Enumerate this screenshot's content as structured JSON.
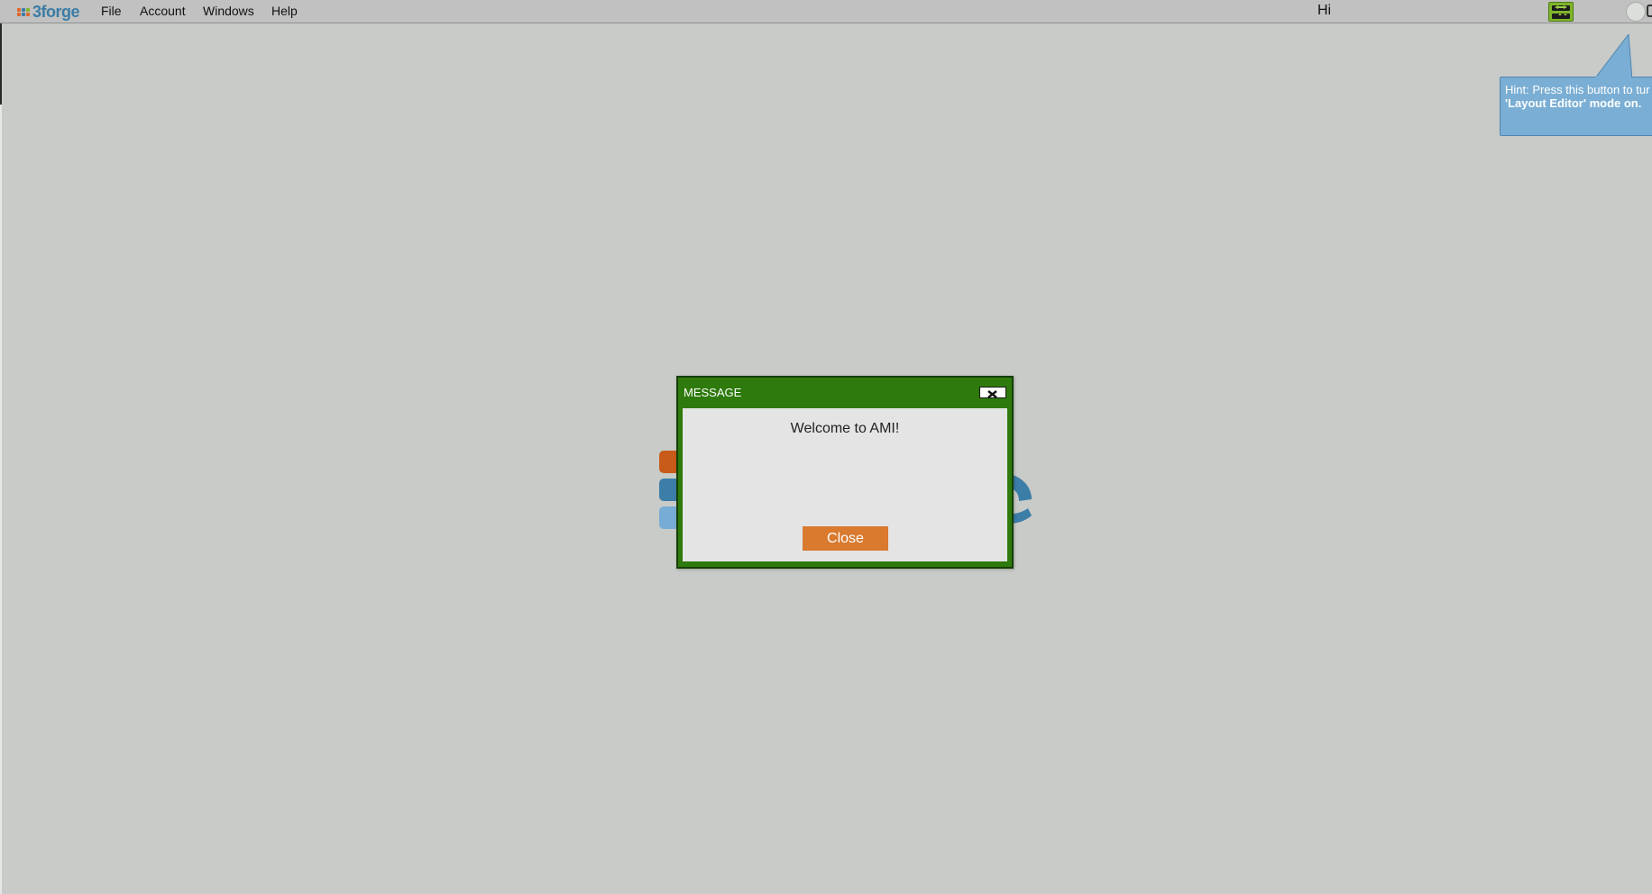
{
  "app": {
    "logo_text": "3forge",
    "logo_dot_colors": [
      "#e0662a",
      "#3b7ca6",
      "#7fb52a",
      "#e0662a",
      "#3b7ca6",
      "#e0662a"
    ]
  },
  "menu": {
    "items": [
      {
        "label": "File"
      },
      {
        "label": "Account"
      },
      {
        "label": "Windows"
      },
      {
        "label": "Help"
      }
    ]
  },
  "header": {
    "greeting": "Hi",
    "layout_editor_icon": "layout-editor-icon",
    "status_icon": "status-circle-icon"
  },
  "hint": {
    "line1": "Hint: Press this button to tur",
    "line2": "'Layout Editor' mode on."
  },
  "dialog": {
    "title": "MESSAGE",
    "message": "Welcome to AMI!",
    "close_label": "Close",
    "close_icon": "close-icon"
  },
  "colors": {
    "background": "#c9cbc9",
    "dialog_frame": "#2e7a0d",
    "close_button": "#d97a2f",
    "hint_bubble": "#7aaed4",
    "logo_orange": "#c85a1a",
    "logo_blue": "#3c7ea8",
    "logo_light_blue": "#76acd6"
  }
}
